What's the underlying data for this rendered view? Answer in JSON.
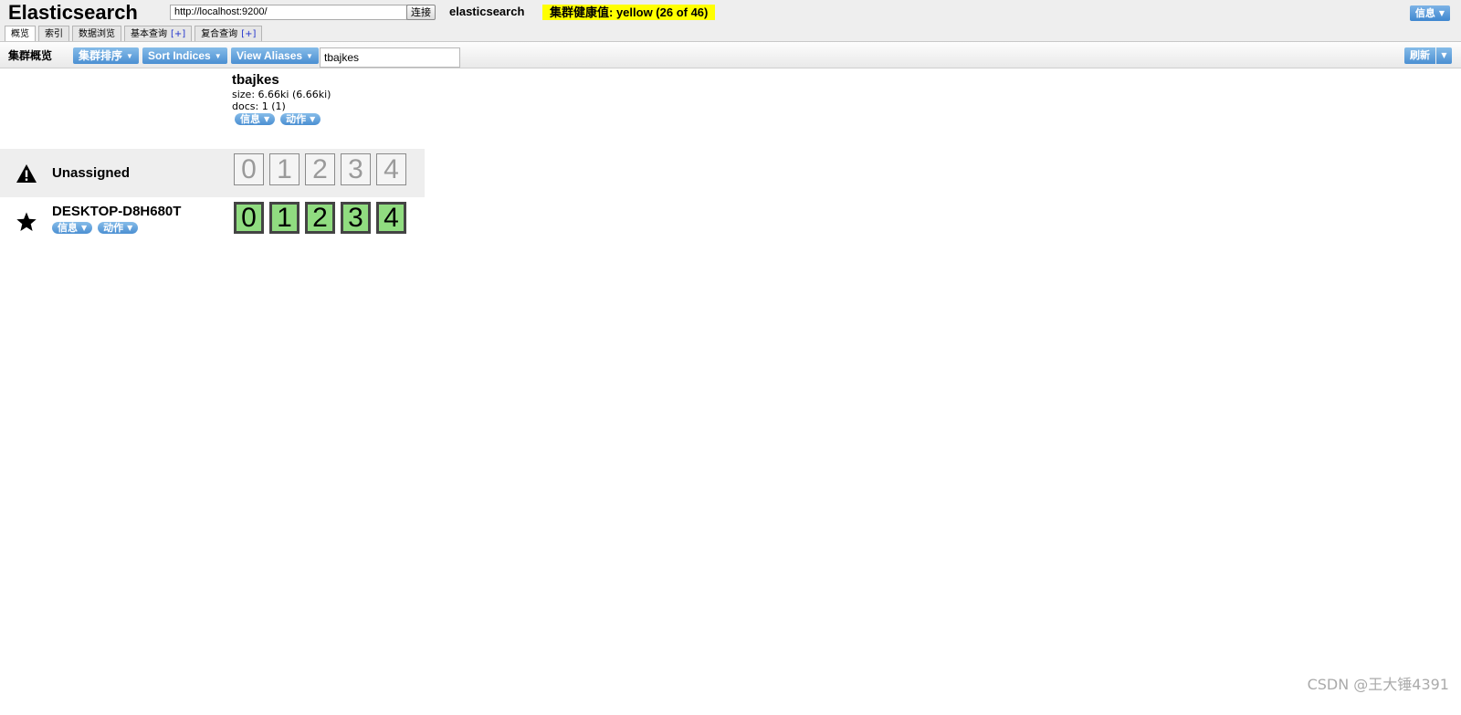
{
  "header": {
    "logo": "Elasticsearch",
    "url_value": "http://localhost:9200/",
    "connect_label": "连接",
    "cluster_name": "elasticsearch",
    "health_text": "集群健康值: yellow (26 of 46)",
    "health_color": "#ffff00",
    "info_label": "信息"
  },
  "tabs": [
    {
      "label": "概览",
      "plus": ""
    },
    {
      "label": "索引",
      "plus": ""
    },
    {
      "label": "数据浏览",
      "plus": ""
    },
    {
      "label": "基本查询",
      "plus": "[+]"
    },
    {
      "label": "复合查询",
      "plus": "[+]"
    }
  ],
  "toolbar": {
    "title": "集群概览",
    "sort_cluster_label": "集群排序",
    "sort_indices_label": "Sort Indices",
    "view_aliases_label": "View Aliases",
    "filter_value": "tbajkes",
    "refresh_label": "刷新"
  },
  "index": {
    "name": "tbajkes",
    "size": "size: 6.66ki (6.66ki)",
    "docs": "docs: 1 (1)",
    "info_label": "信息",
    "action_label": "动作"
  },
  "rows": {
    "unassigned": {
      "label": "Unassigned",
      "icon": "warning-icon",
      "shards": [
        "0",
        "1",
        "2",
        "3",
        "4"
      ]
    },
    "node": {
      "label": "DESKTOP-D8H680T",
      "icon": "star-icon",
      "info_label": "信息",
      "action_label": "动作",
      "shards": [
        "0",
        "1",
        "2",
        "3",
        "4"
      ]
    }
  },
  "colors": {
    "shard_started": "#90dc80",
    "button_blue": "#4b8fd2"
  },
  "watermark": "CSDN @王大锤4391"
}
